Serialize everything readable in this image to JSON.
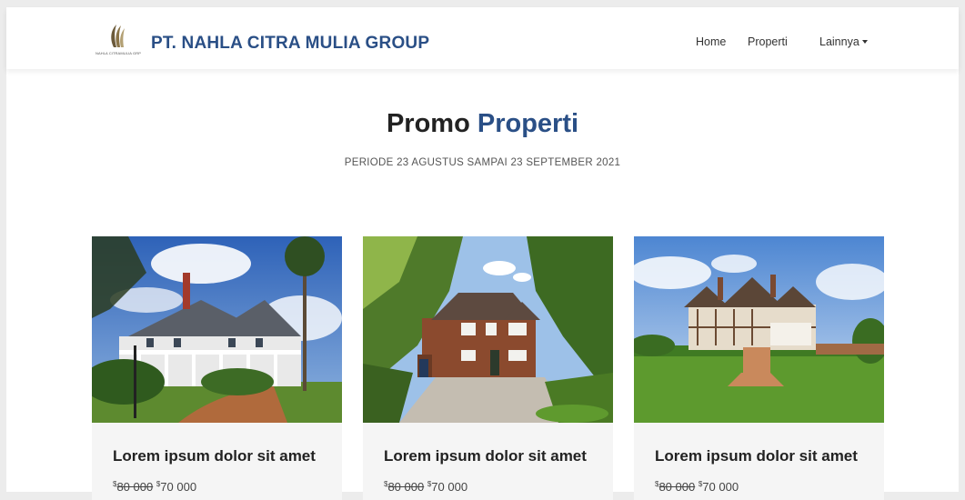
{
  "navbar": {
    "logo_text": "NAHLA CITRAMULIA GRP",
    "brand_name": "PT. NAHLA CITRA MULIA GROUP",
    "links": [
      {
        "label": "Home"
      },
      {
        "label": "Properti"
      },
      {
        "label": "Lainnya"
      }
    ]
  },
  "hero": {
    "title_plain": "Promo",
    "title_accent": "Properti",
    "subtitle": "PERIODE 23 AGUSTUS SAMPAI 23 SEPTEMBER 2021"
  },
  "cards": [
    {
      "title": "Lorem ipsum dolor sit amet",
      "currency": "$",
      "old_price": "80 000",
      "new_price": "70 000",
      "image": "white-victorian-mansion"
    },
    {
      "title": "Lorem ipsum dolor sit amet",
      "currency": "$",
      "old_price": "80 000",
      "new_price": "70 000",
      "image": "brick-house-driveway"
    },
    {
      "title": "Lorem ipsum dolor sit amet",
      "currency": "$",
      "old_price": "80 000",
      "new_price": "70 000",
      "image": "tudor-manor-lawn"
    }
  ],
  "colors": {
    "brand": "#2a4f86",
    "heading": "#222222",
    "card_bg": "#f5f5f5"
  }
}
